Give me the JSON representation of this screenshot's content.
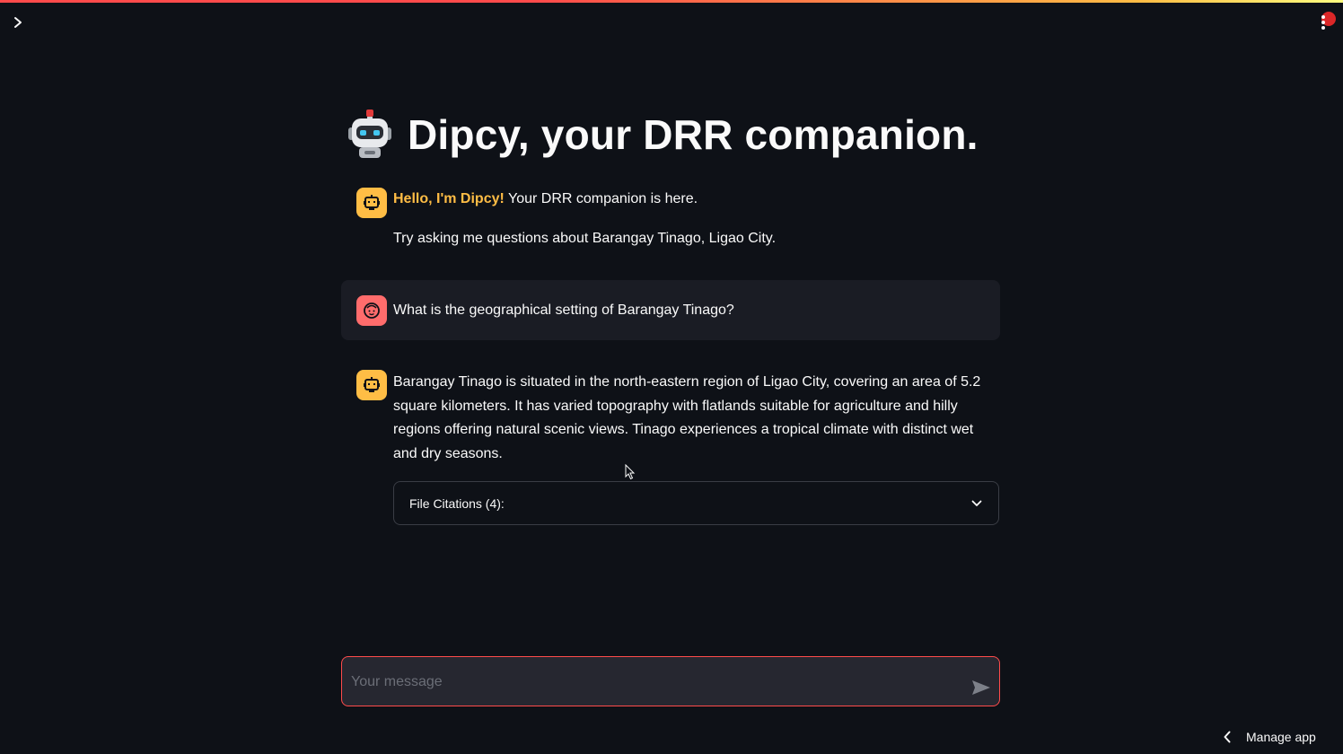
{
  "app": {
    "title": "Dipcy, your DRR companion.",
    "title_icon": "robot-icon",
    "accent_color": "#ff4b4b",
    "bot_avatar_color": "#ffbd45",
    "user_avatar_color": "#ff6c6c"
  },
  "chat": {
    "greeting": {
      "strong": "Hello, I'm Dipcy!",
      "rest": " Your DRR companion is here.",
      "line2": "Try asking me questions about Barangay Tinago, Ligao City."
    },
    "user_message": "What is the geographical setting of Barangay Tinago?",
    "assistant_message": "Barangay Tinago is situated in the north-eastern region of Ligao City, covering an area of 5.2 square kilometers. It has varied topography with flatlands suitable for agriculture and hilly regions offering natural scenic views. Tinago experiences a tropical climate with distinct wet and dry seasons.",
    "citations_label": "File Citations (4):"
  },
  "input": {
    "placeholder": "Your message",
    "value": ""
  },
  "footer": {
    "manage_app_label": "Manage app"
  }
}
